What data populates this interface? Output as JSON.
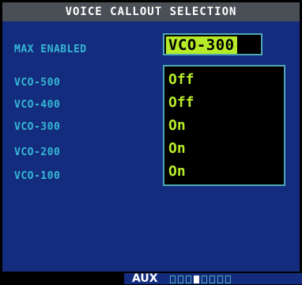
{
  "title": "VOICE CALLOUT SELECTION",
  "max_enabled": {
    "label": "MAX ENABLED",
    "value": "VCO-300"
  },
  "callouts": [
    {
      "label": "VCO-500",
      "value": "Off"
    },
    {
      "label": "VCO-400",
      "value": "Off"
    },
    {
      "label": "VCO-300",
      "value": "On"
    },
    {
      "label": "VCO-200",
      "value": "On"
    },
    {
      "label": "VCO-100",
      "value": "On"
    }
  ],
  "status_bar": {
    "page_group": "AUX",
    "page_count": 8,
    "active_page": 4
  },
  "colors": {
    "background": "#142c7e",
    "title_bar": "#4a4f55",
    "label_cyan": "#35b8d4",
    "value_green": "#b6eb28",
    "field_border": "#4fa7b6"
  }
}
